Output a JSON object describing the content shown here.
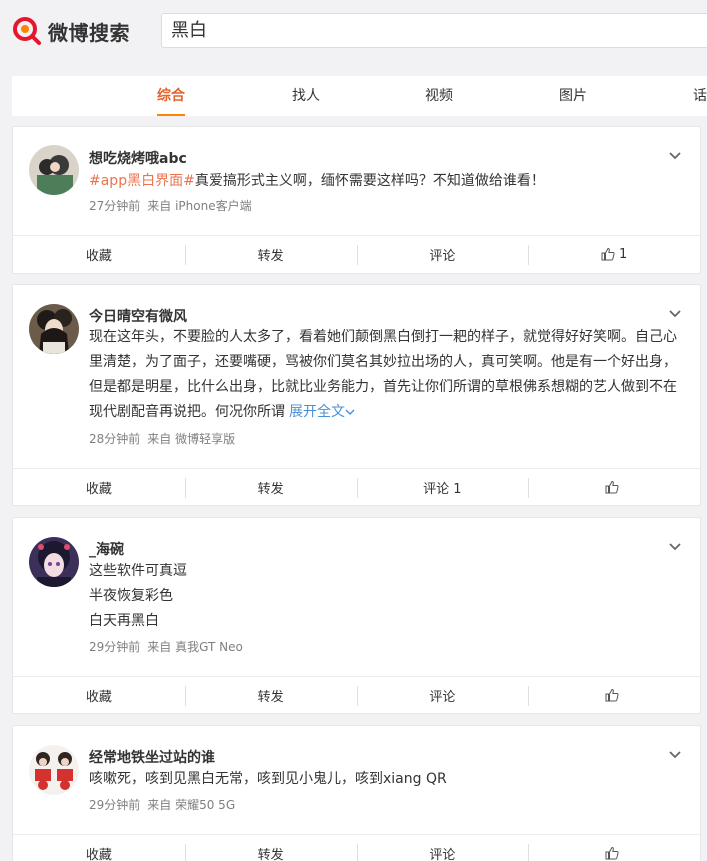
{
  "brand": {
    "logo_text": "微博搜索"
  },
  "search": {
    "query": "黑白"
  },
  "tabs": [
    {
      "label": "综合",
      "active": true
    },
    {
      "label": "找人"
    },
    {
      "label": "视频"
    },
    {
      "label": "图片"
    },
    {
      "label": "话"
    }
  ],
  "accent": "#ff8200",
  "posts": [
    {
      "author": "想吃烧烤哦abc",
      "topic": "#app黑白界面#",
      "text": "真爱搞形式主义啊，缅怀需要这样吗？不知道做给谁看！",
      "time": "27分钟前",
      "source": "来自 iPhone客户端",
      "actions": {
        "fav": "收藏",
        "repost": "转发",
        "comment": "评论",
        "like": "1"
      }
    },
    {
      "author": "今日晴空有微风",
      "text": "现在这年头，不要脸的人太多了，看着她们颠倒黑白倒打一耙的样子，就觉得好好笑啊。自己心里清楚，为了面子，还要嘴硬，骂被你们莫名其妙拉出场的人，真可笑啊。他是有一个好出身，但是都是明星，比什么出身，比就比业务能力，首先让你们所谓的草根佛系想糊的艺人做到不在现代剧配音再说把。何况你所谓",
      "expand": "展开全文",
      "time": "28分钟前",
      "source": "来自 微博轻享版",
      "actions": {
        "fav": "收藏",
        "repost": "转发",
        "comment": "评论 1",
        "like": ""
      }
    },
    {
      "author": "_海碗",
      "lines": [
        "这些软件可真逗",
        "半夜恢复彩色",
        "白天再黑白"
      ],
      "time": "29分钟前",
      "source": "来自 真我GT Neo",
      "actions": {
        "fav": "收藏",
        "repost": "转发",
        "comment": "评论",
        "like": ""
      }
    },
    {
      "author": "经常地铁坐过站的谁",
      "text": "咳嗽死，咳到见黑白无常，咳到见小鬼儿，咳到xiang QR",
      "time": "29分钟前",
      "source": "来自 荣耀50 5G",
      "actions": {
        "fav": "收藏",
        "repost": "转发",
        "comment": "评论",
        "like": ""
      }
    }
  ]
}
